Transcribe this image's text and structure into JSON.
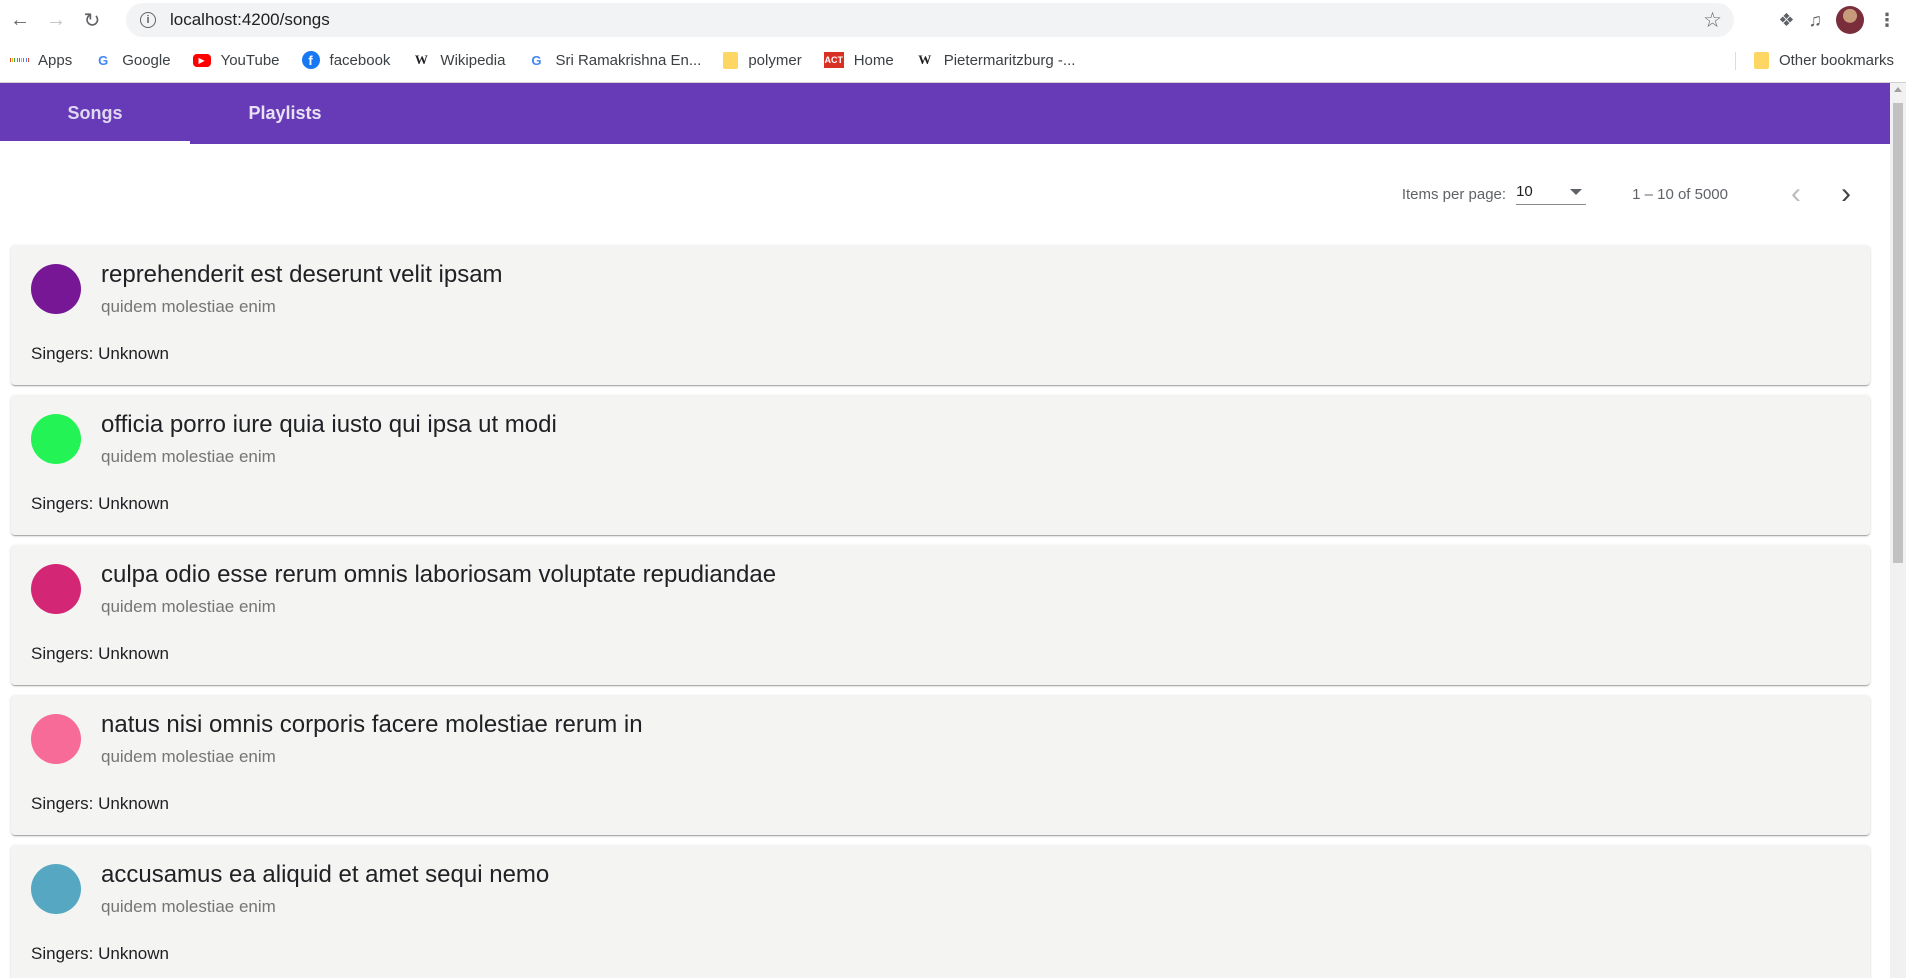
{
  "browser": {
    "url": "localhost:4200/songs",
    "bookmarks": [
      {
        "label": "Apps",
        "icon": "apps-grid-icon"
      },
      {
        "label": "Google",
        "icon": "google-icon"
      },
      {
        "label": "YouTube",
        "icon": "youtube-icon"
      },
      {
        "label": "facebook",
        "icon": "facebook-icon"
      },
      {
        "label": "Wikipedia",
        "icon": "wikipedia-icon"
      },
      {
        "label": "Sri Ramakrishna En...",
        "icon": "google-icon"
      },
      {
        "label": "polymer",
        "icon": "folder-icon"
      },
      {
        "label": "Home",
        "icon": "act-logo-icon"
      },
      {
        "label": "Pietermaritzburg -...",
        "icon": "wikipedia-icon"
      }
    ],
    "other_bookmarks": "Other bookmarks"
  },
  "tabs": [
    {
      "label": "Songs",
      "active": true
    },
    {
      "label": "Playlists",
      "active": false
    }
  ],
  "paginator": {
    "items_per_page_label": "Items per page:",
    "page_size": "10",
    "range_label": "1 – 10 of 5000"
  },
  "songs": [
    {
      "title": "reprehenderit est deserunt velit ipsam",
      "album": "quidem molestiae enim",
      "singers": "Singers: Unknown",
      "color": "#771796"
    },
    {
      "title": "officia porro iure quia iusto qui ipsa ut modi",
      "album": "quidem molestiae enim",
      "singers": "Singers: Unknown",
      "color": "#24f355"
    },
    {
      "title": "culpa odio esse rerum omnis laboriosam voluptate repudiandae",
      "album": "quidem molestiae enim",
      "singers": "Singers: Unknown",
      "color": "#d32776"
    },
    {
      "title": "natus nisi omnis corporis facere molestiae rerum in",
      "album": "quidem molestiae enim",
      "singers": "Singers: Unknown",
      "color": "#f66b97"
    },
    {
      "title": "accusamus ea aliquid et amet sequi nemo",
      "album": "quidem molestiae enim",
      "singers": "Singers: Unknown",
      "color": "#56a8c2"
    }
  ],
  "colors": {
    "primary": "#673ab7",
    "card_bg": "#f4f4f3"
  }
}
